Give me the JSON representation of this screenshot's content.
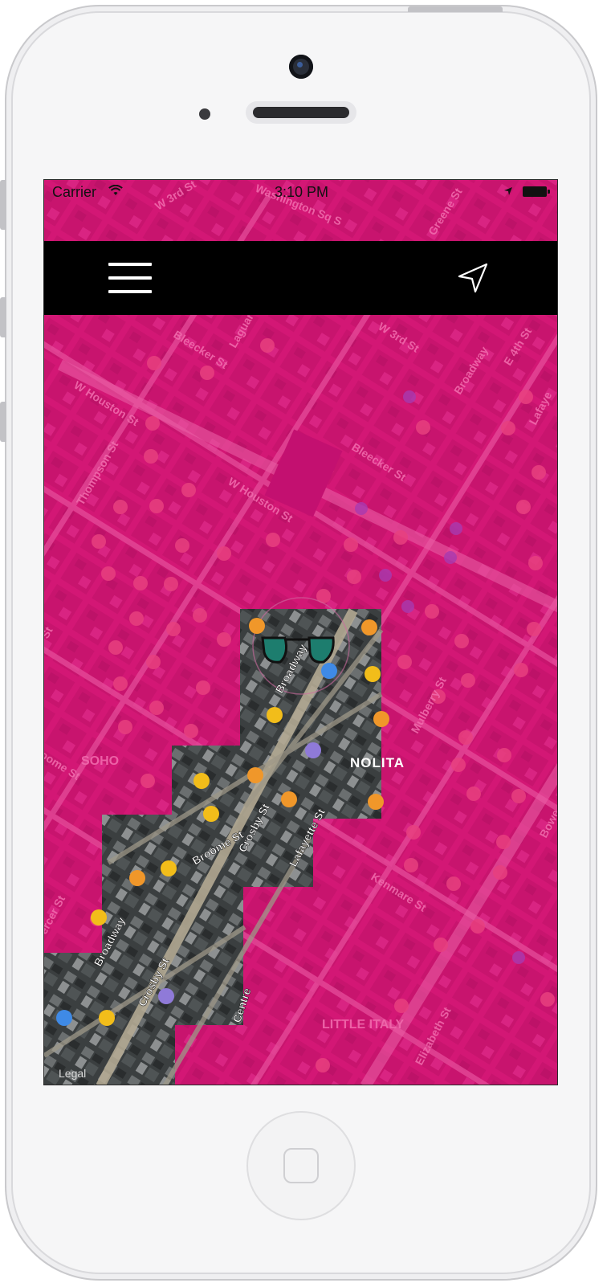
{
  "status_bar": {
    "carrier": "Carrier",
    "time": "3:10 PM"
  },
  "nav_bar": {
    "menu_icon": "hamburger-menu-icon",
    "location_icon": "navigation-arrow-icon"
  },
  "map": {
    "overlay_color": "#d61a78",
    "street_labels": {
      "w3rd_top": "W 3rd St",
      "washington": "Washington Sq S",
      "greene": "Greene St",
      "laguardia": "Laguardia",
      "bleecker_left": "Bleecker St",
      "w3rd_mid": "W 3rd St",
      "broadway_top": "Broadway",
      "e4th": "E 4th St",
      "lafayette_top": "Lafaye",
      "w_houston_left": "W Houston St",
      "thompson": "Thompson St",
      "w_houston_mid": "W Houston St",
      "bleecker_right": "Bleecker St",
      "soho": "SOHO",
      "boome": "oome St",
      "mulberry": "Mulberry St",
      "bowery": "Bowe",
      "broadway_sat": "Broadway",
      "nolita": "NOLITA",
      "crosby_top": "Crosby St",
      "lafayette_sat": "Lafayette St",
      "broome": "Broome St",
      "broadway_low": "Broadway",
      "crosby_low": "Crosby St",
      "centre": "Centre",
      "mercer": "ercer St",
      "kenmare": "Kenmare St",
      "elizabeth": "Elizabeth St",
      "little_italy": "LITTLE ITALY",
      "st_left": "St"
    },
    "legal": "Legal"
  }
}
